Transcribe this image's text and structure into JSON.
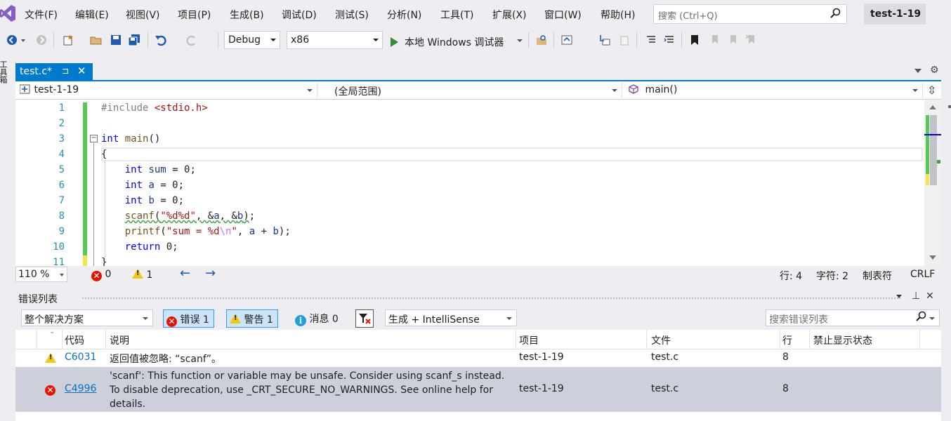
{
  "menu": [
    "文件(F)",
    "编辑(E)",
    "视图(V)",
    "项目(P)",
    "生成(B)",
    "调试(D)",
    "测试(S)",
    "分析(N)",
    "工具(T)",
    "扩展(X)",
    "窗口(W)",
    "帮助(H)"
  ],
  "search": {
    "placeholder": "搜索 (Ctrl+Q)"
  },
  "solution_title": "test-1-19",
  "toolbar": {
    "config": "Debug",
    "platform": "x86",
    "run_label": "本地 Windows 调试器"
  },
  "left_tab": "工具箱",
  "doc_tab": {
    "name": "test.c*",
    "pin": "⊐",
    "close": "✕"
  },
  "nav": {
    "project": "test-1-19",
    "scope": "(全局范围)",
    "member": "main()"
  },
  "editor": {
    "line_numbers": [
      "1",
      "2",
      "3",
      "4",
      "5",
      "6",
      "7",
      "8",
      "9",
      "10",
      "11"
    ],
    "fold_mark": "−"
  },
  "status": {
    "zoom": "110 %",
    "errors": "0",
    "warnings": "1",
    "line": "行: 4",
    "char": "字符: 2",
    "tab": "制表符",
    "eol": "CRLF"
  },
  "error_list": {
    "title": "错误列表",
    "scope": "整个解决方案",
    "errors_btn": "错误 1",
    "warnings_btn": "警告 1",
    "messages_btn": "消息 0",
    "build_filter": "生成 + IntelliSense",
    "search_placeholder": "搜索错误列表",
    "columns": {
      "code": "代码",
      "desc": "说明",
      "project": "项目",
      "file": "文件",
      "line": "行",
      "suppress": "禁止显示状态"
    },
    "rows": [
      {
        "severity": "warning",
        "code": "C6031",
        "desc": "返回值被忽略: “scanf”。",
        "project": "test-1-19",
        "file": "test.c",
        "line": "8"
      },
      {
        "severity": "error",
        "code": "C4996",
        "desc": "'scanf': This function or variable may be unsafe. Consider using scanf_s instead. To disable deprecation, use _CRT_SECURE_NO_WARNINGS. See online help for details.",
        "project": "test-1-19",
        "file": "test.c",
        "line": "8"
      }
    ]
  },
  "colors": {
    "accent": "#007acc",
    "error": "#e51400",
    "warning": "#f2c811",
    "gutter_green": "#57c85a",
    "keyword": "#0000ff",
    "selected_row": "#cdd0da"
  }
}
